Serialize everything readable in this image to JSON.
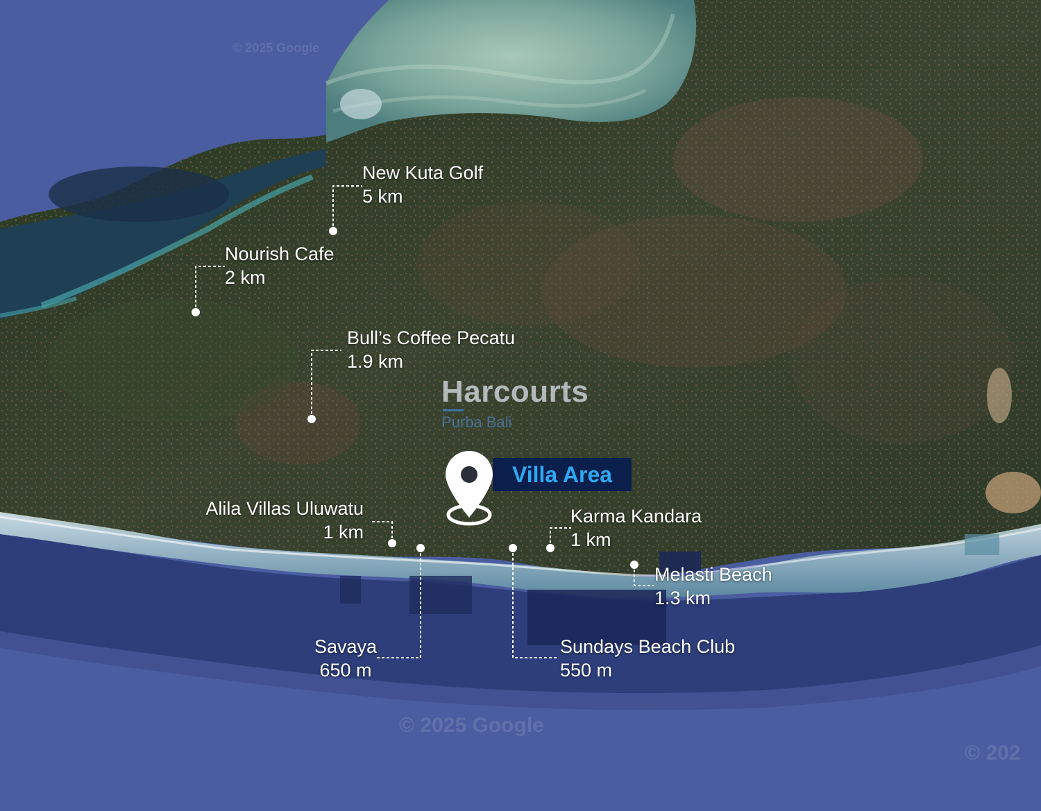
{
  "map": {
    "villa_label": "Villa Area",
    "watermark": {
      "brand": "Harcourts",
      "sub": "Purba Bali"
    },
    "google_watermarks": [
      "© 2025 Google",
      "© 2025 Google",
      "© 202"
    ],
    "colors": {
      "sea": "#4a5da0",
      "coast_water": "#3d8a93",
      "land": "#2c3c24",
      "badge_bg": "#0b1f4d",
      "badge_text": "#2fa8f0",
      "label": "#ffffff"
    },
    "points_of_interest": [
      {
        "name": "New Kuta Golf",
        "distance": "5 km"
      },
      {
        "name": "Nourish Cafe",
        "distance": "2 km"
      },
      {
        "name": "Bull’s Coffee Pecatu",
        "distance": "1.9 km"
      },
      {
        "name": "Alila Villas Uluwatu",
        "distance": "1 km"
      },
      {
        "name": "Karma Kandara",
        "distance": "1 km"
      },
      {
        "name": "Melasti Beach",
        "distance": "1.3 km"
      },
      {
        "name": "Savaya",
        "distance": "650 m"
      },
      {
        "name": "Sundays Beach Club",
        "distance": "550 m"
      }
    ]
  }
}
